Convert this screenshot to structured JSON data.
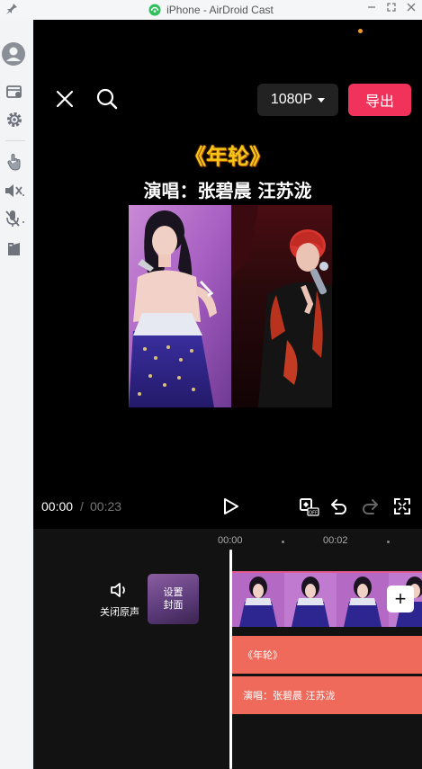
{
  "window": {
    "title": "iPhone - AirDroid Cast",
    "icons": [
      "pin-icon",
      "airdroid-logo",
      "minimize-icon",
      "maximize-icon",
      "close-window-icon"
    ]
  },
  "sidebar": {
    "items": [
      {
        "name": "avatar"
      },
      {
        "name": "screen-record-icon"
      },
      {
        "name": "settings-icon"
      },
      {
        "name": "touch-control-icon"
      },
      {
        "name": "audio-mute-icon"
      },
      {
        "name": "mic-mute-icon"
      },
      {
        "name": "book-icon"
      }
    ]
  },
  "editor": {
    "resolution": "1080P",
    "export_label": "导出",
    "video_title": "《年轮》",
    "singers_line": "演唱：张碧晨 汪苏泷",
    "time_current": "00:00",
    "time_separator": "/",
    "time_total": "00:23"
  },
  "timeline": {
    "ruler_labels": [
      "00:00",
      "00:02"
    ],
    "mute_label": "关闭原声",
    "cover_label_line1": "设置",
    "cover_label_line2": "封面",
    "text_clips": [
      "《年轮》",
      "演唱：张碧晨 汪苏泷"
    ],
    "add_label": "+"
  },
  "colors": {
    "accent_export": "#f1325a",
    "title_gold": "#f5c518",
    "text_track": "#f06a5b",
    "indicator_orange": "#f29b2a"
  }
}
